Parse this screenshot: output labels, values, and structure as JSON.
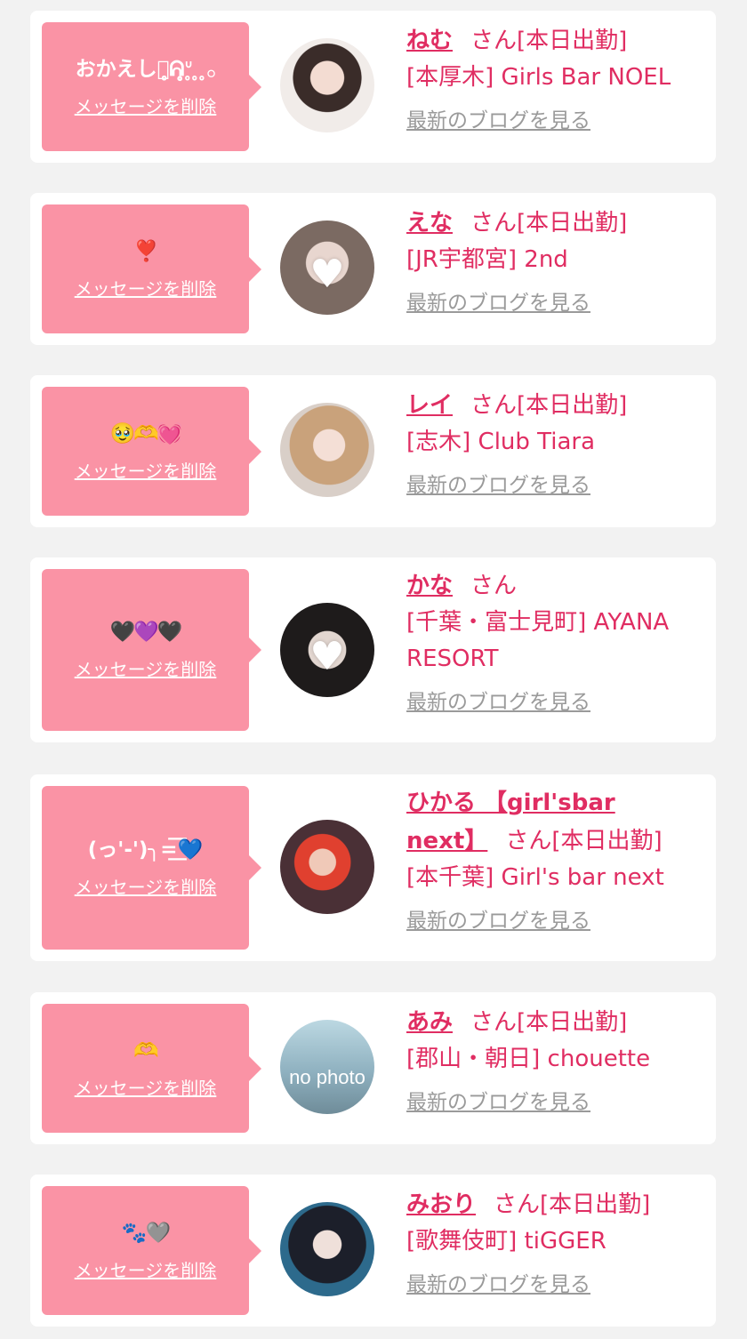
{
  "delete_label": "メッセージを削除",
  "blog_label": "最新のブログを見る",
  "san_label": "さん",
  "colors": {
    "page_bg": "#f2f2f2",
    "bubble_bg": "#fa93a5",
    "accent_text": "#e02d62",
    "link_gray": "#9a9a9a"
  },
  "cards": [
    {
      "message": "おかえしっ̥̥̥ᕱ̥ᐡ̥ ̥ ̥𓂂",
      "name": "ねむ",
      "status": "[本日出勤]",
      "shop": "[本厚木] Girls Bar NOEL",
      "avatar": "girl-photo"
    },
    {
      "message": "❣️",
      "name": "えな",
      "status": "[本日出勤]",
      "shop": "[JR宇都宮] 2nd",
      "avatar": "girl-photo-heart"
    },
    {
      "message": "🥹🫶💓",
      "name": "レイ",
      "status": "[本日出勤]",
      "shop": "[志木] Club Tiara",
      "avatar": "girl-photo"
    },
    {
      "message": "🖤💜🖤",
      "name": "かな",
      "status": "",
      "shop": "[千葉・富士見町] AYANA RESORT",
      "avatar": "girl-photo-heart"
    },
    {
      "message": "(っ'-')╮=͟͟͞͞💙",
      "name_line1": "ひかる 【girl'sbar",
      "name_line2": "next】",
      "status": "[本日出勤]",
      "shop": "[本千葉] Girl's bar next",
      "avatar": "girl-photo"
    },
    {
      "message": "🫶",
      "name": "あみ",
      "status": "[本日出勤]",
      "shop": "[郡山・朝日] chouette",
      "avatar": "no-photo",
      "avatar_text": "no photo"
    },
    {
      "message": "🐾🩶",
      "name": "みおり",
      "status": "[本日出勤]",
      "shop": "[歌舞伎町] tiGGER",
      "avatar": "girl-photo"
    }
  ]
}
